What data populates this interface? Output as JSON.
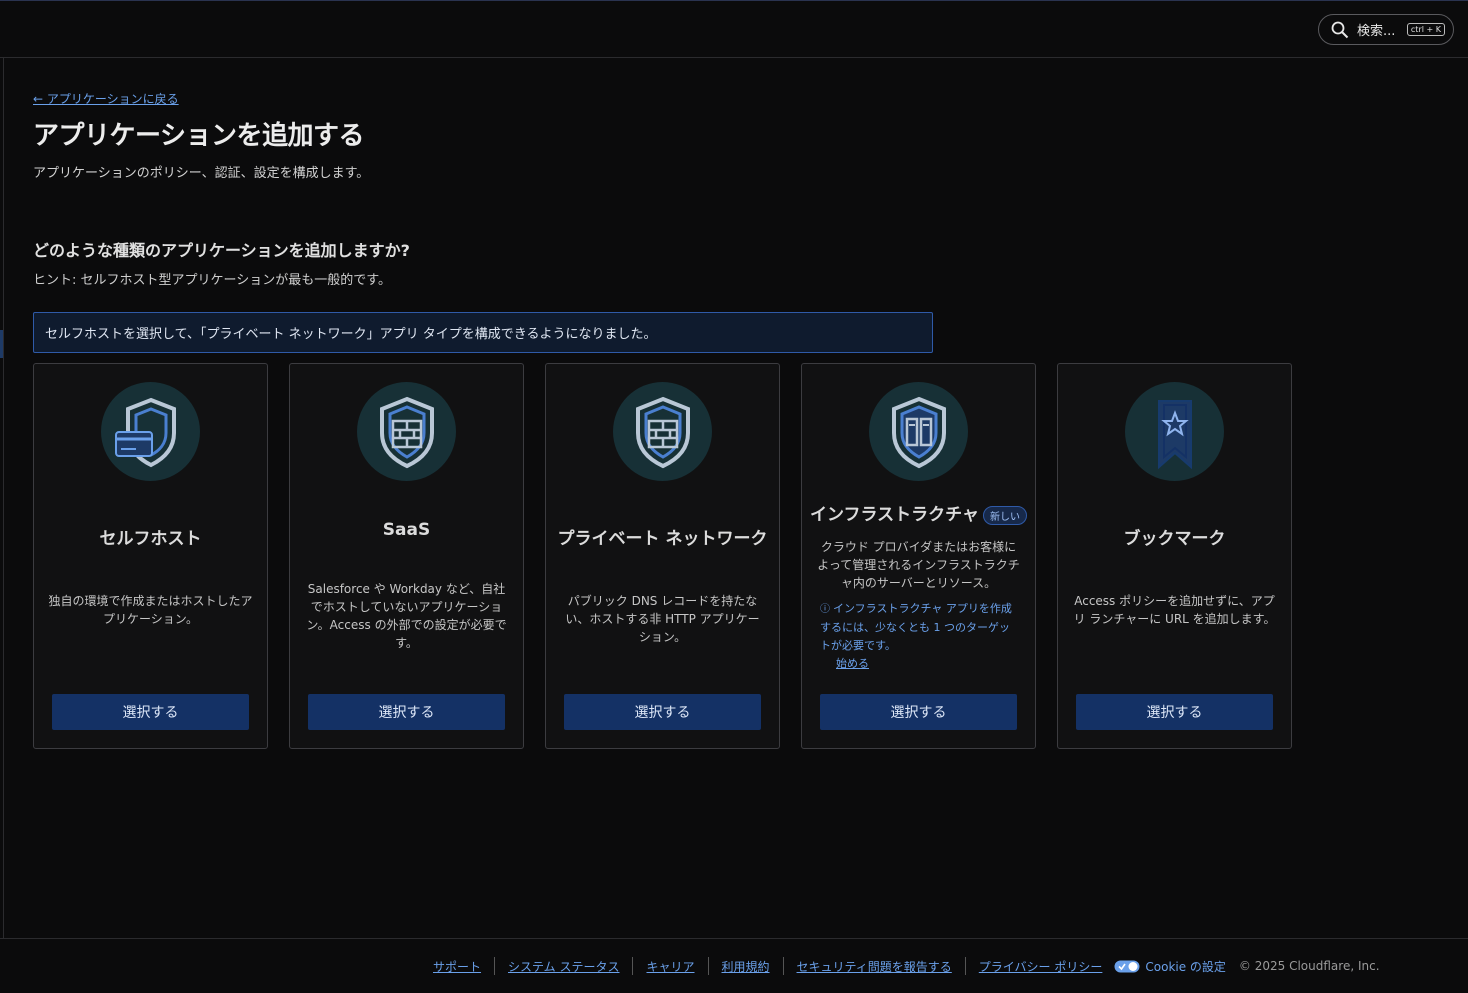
{
  "header": {
    "search_label": "検索...",
    "search_shortcut": "ctrl + K"
  },
  "page": {
    "back_link": "← アプリケーションに戻る",
    "title": "アプリケーションを追加する",
    "subtitle": "アプリケーションのポリシー、認証、設定を構成します。",
    "question": "どのような種類のアプリケーションを追加しますか?",
    "hint": "ヒント: セルフホスト型アプリケーションが最も一般的です。",
    "banner": "セルフホストを選択して、「プライベート ネットワーク」アプリ タイプを構成できるようになりました。"
  },
  "cards": [
    {
      "title": "セルフホスト",
      "icon": "shield-card-icon",
      "description": "独自の環境で作成またはホストしたアプリケーション。",
      "button": "選択する"
    },
    {
      "title": "SaaS",
      "icon": "shield-bricks-icon",
      "description": "Salesforce や Workday など、自社でホストしていないアプリケーション。Access の外部での設定が必要です。",
      "button": "選択する"
    },
    {
      "title": "プライベート ネットワーク",
      "icon": "shield-bricks-icon",
      "description": "パブリック DNS レコードを持たない、ホストする非 HTTP アプリケーション。",
      "button": "選択する"
    },
    {
      "title": "インフラストラクチャ",
      "badge": "新しい",
      "icon": "shield-server-icon",
      "description": "クラウド プロバイダまたはお客様によって管理されるインフラストラクチャ内のサーバーとリソース。",
      "note": "インフラストラクチャ アプリを作成するには、少なくとも 1 つのターゲットが必要です。",
      "note_link": "始める",
      "button": "選択する"
    },
    {
      "title": "ブックマーク",
      "icon": "bookmark-star-icon",
      "description": "Access ポリシーを追加せずに、アプリ ランチャーに URL を追加します。",
      "button": "選択する"
    }
  ],
  "footer": {
    "links": [
      "サポート",
      "システム ステータス",
      "キャリア",
      "利用規約",
      "セキュリティ問題を報告する",
      "プライバシー ポリシー"
    ],
    "cookie": "Cookie の設定",
    "copyright": "© 2025 Cloudflare, Inc."
  },
  "colors": {
    "background": "#0b0b0c",
    "accent_link": "#6aa0ea",
    "button": "#143165",
    "icon_circle": "#173036"
  }
}
